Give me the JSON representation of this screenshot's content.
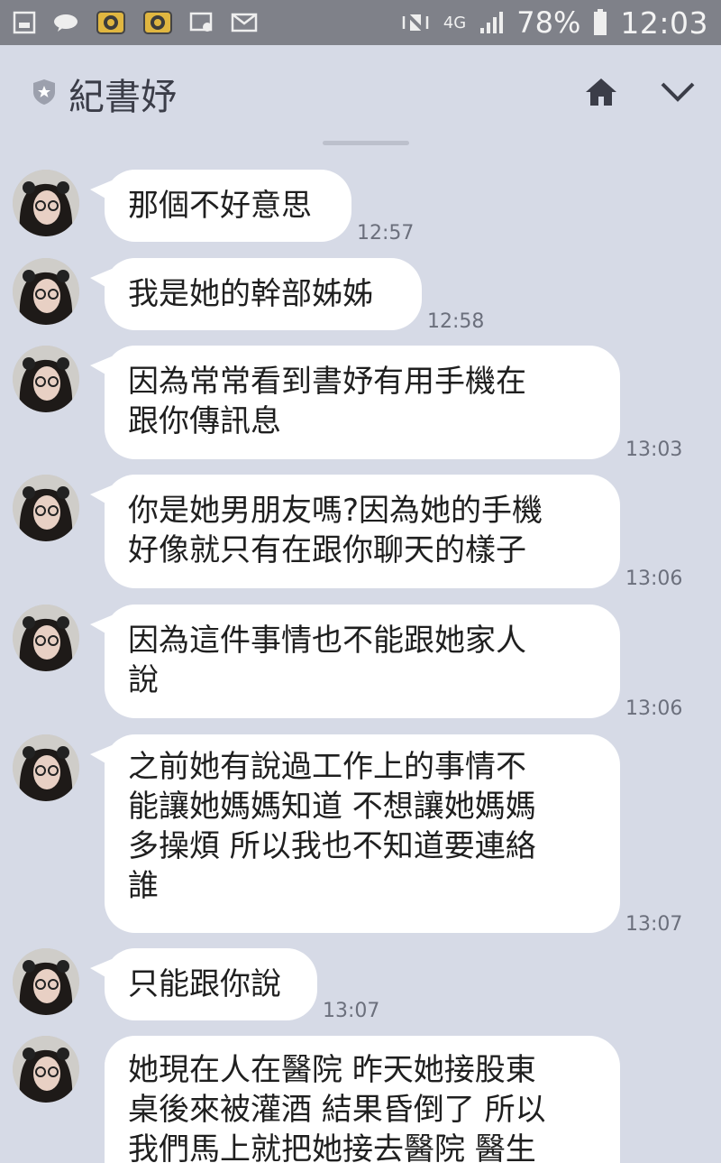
{
  "status_bar": {
    "battery": "78%",
    "time": "12:03",
    "network": "4G"
  },
  "header": {
    "title": "紀書妤",
    "icons": [
      "shield-star-icon",
      "home-icon",
      "chevron-down-icon"
    ]
  },
  "messages": [
    {
      "text": "那個不好意思",
      "time": "12:57"
    },
    {
      "text": "我是她的幹部姊姊",
      "time": "12:58"
    },
    {
      "lines": [
        "因為常常看到書妤有用手機在",
        "跟你傳訊息"
      ],
      "time": "13:03"
    },
    {
      "lines": [
        "你是她男朋友嗎?因為她的手機",
        "好像就只有在跟你聊天的樣子"
      ],
      "time": "13:06"
    },
    {
      "lines": [
        "因為這件事情也不能跟她家人",
        "說"
      ],
      "time": "13:06"
    },
    {
      "lines": [
        "之前她有說過工作上的事情不",
        "能讓她媽媽知道 不想讓她媽媽",
        "多操煩 所以我也不知道要連絡",
        "誰"
      ],
      "time": "13:07"
    },
    {
      "text": "只能跟你說",
      "time": "13:07"
    },
    {
      "lines": [
        "她現在人在醫院 昨天她接股東",
        "桌後來被灌酒 結果昏倒了 所以",
        "我們馬上就把她接去醫院 醫生"
      ]
    }
  ]
}
